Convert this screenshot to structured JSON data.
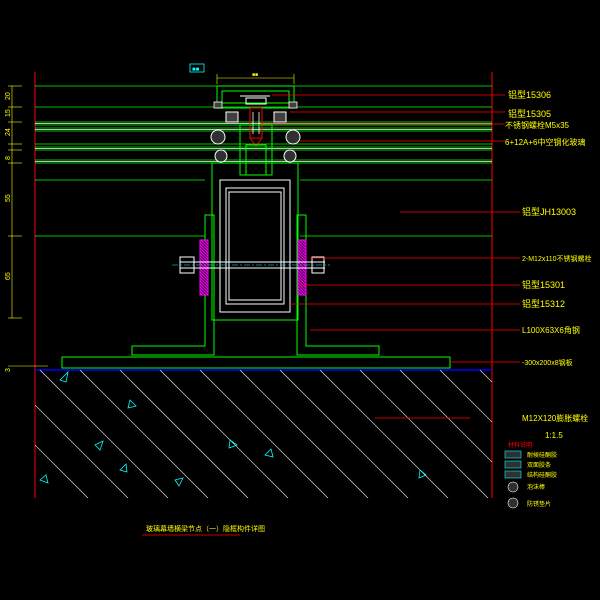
{
  "drawing": {
    "top_tag": "■■",
    "dim_top": "■■",
    "title": "玻璃幕墙横梁节点（一）隐框构件详图",
    "scale": "1:1.5"
  },
  "dimensions_left": [
    "20",
    "15",
    "24",
    "8",
    "55",
    "65",
    "3"
  ],
  "callouts": [
    "铝型15306",
    "铝型15305",
    "不锈钢螺栓M5x35",
    "6+12A+6中空钢化玻璃",
    "铝型JH13003",
    "2-M12x110不锈钢螺栓",
    "铝型15301",
    "铝型15312",
    "L100X63X6角钢",
    "-300x200x8钢板",
    "M12X120膨胀螺栓"
  ],
  "legend": {
    "header": "材料说明:",
    "items": [
      "耐候硅酮胶",
      "双面胶条",
      "结构硅酮胶",
      "泡沫棒",
      "防锈垫片"
    ]
  },
  "colors": {
    "background": "#000000",
    "line_green": "#00ff00",
    "line_cyan": "#00ffff",
    "line_red": "#ff0000",
    "line_magenta": "#ff00ff",
    "line_white": "#ffffff",
    "text_yellow": "#ffff00",
    "line_blue": "#0000ff"
  }
}
